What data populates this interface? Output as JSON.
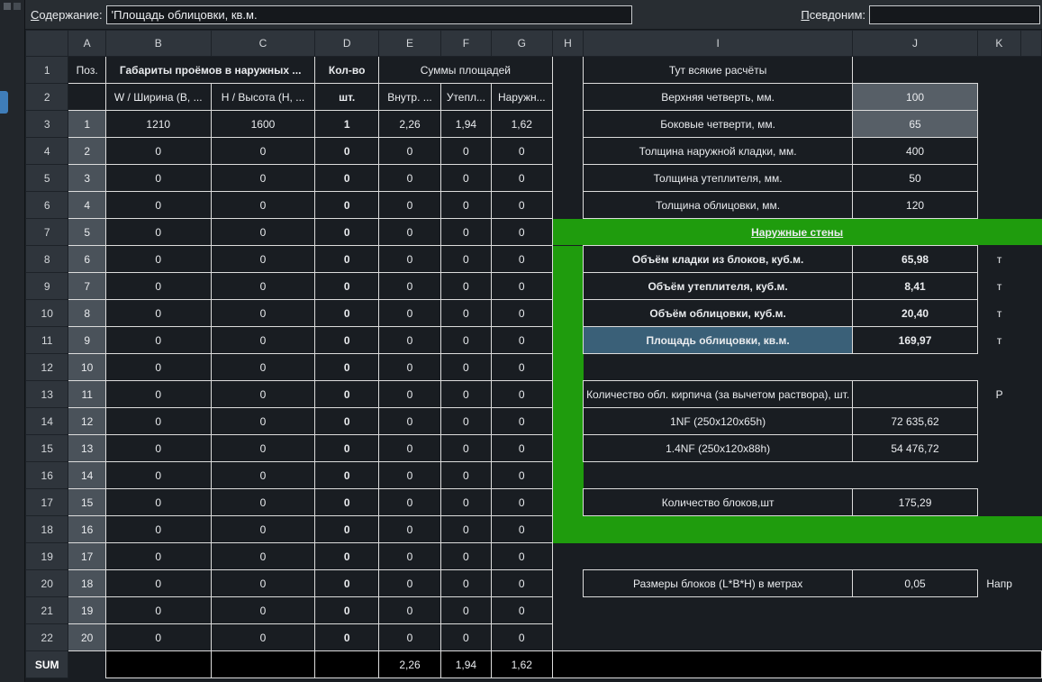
{
  "chrome": {
    "content_label_initial": "С",
    "content_label_rest": "одержание:",
    "content_value": "'Площадь облицовки, кв.м.",
    "alias_label_initial": "П",
    "alias_label_rest": "севдоним:",
    "alias_value": ""
  },
  "colors": {
    "green": "#1f9c0d",
    "selection": "#3a6078",
    "range-fill": "#575f67",
    "badge": "#4a525a",
    "black-row": "#000000",
    "cell-border": "#dcdcdc",
    "header-bg": "#2f353c",
    "cell-bg": "#191d22",
    "topbar-bg": "#282d32",
    "accent-tab": "#3f7db9"
  },
  "sheet": {
    "col_headers": [
      "A",
      "B",
      "C",
      "D",
      "E",
      "F",
      "G",
      "H",
      "I",
      "J",
      "K",
      ""
    ],
    "rows": [
      {
        "h": "1",
        "c": [
          [
            "Поз.",
            "b"
          ],
          [
            "Габариты проёмов в наружных ...",
            "b bold l",
            2
          ],
          [
            "Кол-во",
            "b bold"
          ],
          [
            "Суммы площадей",
            "b",
            3
          ],
          [
            "",
            ""
          ],
          [
            "Тут всякие расчёты",
            "b"
          ],
          [
            "",
            ""
          ],
          [
            "",
            ""
          ],
          [
            "",
            ""
          ]
        ]
      },
      {
        "h": "2",
        "c": [
          [
            "",
            "b"
          ],
          [
            "W / Ширина (В, ...",
            "b l"
          ],
          [
            "H / Высота (H, ...",
            "b l"
          ],
          [
            "шт.",
            "b bold"
          ],
          [
            "Внутр. ...",
            "b l"
          ],
          [
            "Утепл...",
            "b l"
          ],
          [
            "Наружн...",
            "b l"
          ],
          [
            "",
            ""
          ],
          [
            "Верхняя четверть, мм.",
            "b l"
          ],
          [
            "100",
            "range"
          ],
          [
            "",
            ""
          ],
          [
            "",
            ""
          ]
        ]
      },
      {
        "h": "3",
        "c": [
          [
            "1",
            "badge"
          ],
          [
            "1210",
            "b"
          ],
          [
            "1600",
            "b"
          ],
          [
            "1",
            "b bold"
          ],
          [
            "2,26",
            "b"
          ],
          [
            "1,94",
            "b"
          ],
          [
            "1,62",
            "b"
          ],
          [
            "",
            ""
          ],
          [
            "Боковые четверти, мм.",
            "b l"
          ],
          [
            "65",
            "range"
          ],
          [
            "",
            ""
          ],
          [
            "",
            ""
          ]
        ]
      },
      {
        "h": "4",
        "c": [
          [
            "2",
            "badge"
          ],
          [
            "0",
            "b"
          ],
          [
            "0",
            "b"
          ],
          [
            "0",
            "b bold"
          ],
          [
            "0",
            "b"
          ],
          [
            "0",
            "b"
          ],
          [
            "0",
            "b"
          ],
          [
            "",
            ""
          ],
          [
            "Толщина наружной кладки, мм.",
            "b l"
          ],
          [
            "400",
            "b"
          ],
          [
            "",
            ""
          ],
          [
            "",
            ""
          ]
        ]
      },
      {
        "h": "5",
        "c": [
          [
            "3",
            "badge"
          ],
          [
            "0",
            "b"
          ],
          [
            "0",
            "b"
          ],
          [
            "0",
            "b bold"
          ],
          [
            "0",
            "b"
          ],
          [
            "0",
            "b"
          ],
          [
            "0",
            "b"
          ],
          [
            "",
            ""
          ],
          [
            "Толщина утеплителя, мм.",
            "b l"
          ],
          [
            "50",
            "b"
          ],
          [
            "",
            ""
          ],
          [
            "",
            ""
          ]
        ]
      },
      {
        "h": "6",
        "c": [
          [
            "4",
            "badge"
          ],
          [
            "0",
            "b"
          ],
          [
            "0",
            "b"
          ],
          [
            "0",
            "b bold"
          ],
          [
            "0",
            "b"
          ],
          [
            "0",
            "b"
          ],
          [
            "0",
            "b"
          ],
          [
            "",
            ""
          ],
          [
            "Толщина облицовки, мм.",
            "b l"
          ],
          [
            "120",
            "b"
          ],
          [
            "",
            ""
          ],
          [
            "",
            ""
          ]
        ]
      },
      {
        "h": "7",
        "c": [
          [
            "5",
            "badge"
          ],
          [
            "0",
            "b"
          ],
          [
            "0",
            "b"
          ],
          [
            "0",
            "b bold"
          ],
          [
            "0",
            "b"
          ],
          [
            "0",
            "b"
          ],
          [
            "0",
            "b"
          ],
          [
            "Наружные стены",
            "green title",
            5
          ]
        ]
      },
      {
        "h": "8",
        "c": [
          [
            "6",
            "badge"
          ],
          [
            "0",
            "b"
          ],
          [
            "0",
            "b"
          ],
          [
            "0",
            "b bold"
          ],
          [
            "0",
            "b"
          ],
          [
            "0",
            "b"
          ],
          [
            "0",
            "b"
          ],
          [
            "",
            "green"
          ],
          [
            "Объём кладки из блоков, куб.м.",
            "b bold l"
          ],
          [
            "65,98",
            "b bold"
          ],
          [
            "т",
            "ov"
          ],
          [
            "",
            ""
          ]
        ]
      },
      {
        "h": "9",
        "c": [
          [
            "7",
            "badge"
          ],
          [
            "0",
            "b"
          ],
          [
            "0",
            "b"
          ],
          [
            "0",
            "b bold"
          ],
          [
            "0",
            "b"
          ],
          [
            "0",
            "b"
          ],
          [
            "0",
            "b"
          ],
          [
            "",
            "green"
          ],
          [
            "Объём утеплителя, куб.м.",
            "b bold l"
          ],
          [
            "8,41",
            "b bold"
          ],
          [
            "т",
            "ov"
          ],
          [
            "",
            ""
          ]
        ]
      },
      {
        "h": "10",
        "c": [
          [
            "8",
            "badge"
          ],
          [
            "0",
            "b"
          ],
          [
            "0",
            "b"
          ],
          [
            "0",
            "b bold"
          ],
          [
            "0",
            "b"
          ],
          [
            "0",
            "b"
          ],
          [
            "0",
            "b"
          ],
          [
            "",
            "green"
          ],
          [
            "Объём облицовки, куб.м.",
            "b bold l"
          ],
          [
            "20,40",
            "b bold"
          ],
          [
            "т",
            "ov"
          ],
          [
            "",
            ""
          ]
        ]
      },
      {
        "h": "11",
        "c": [
          [
            "9",
            "badge"
          ],
          [
            "0",
            "b"
          ],
          [
            "0",
            "b"
          ],
          [
            "0",
            "b bold"
          ],
          [
            "0",
            "b"
          ],
          [
            "0",
            "b"
          ],
          [
            "0",
            "b"
          ],
          [
            "",
            "green"
          ],
          [
            "Площадь облицовки, кв.м.",
            "sel bold l"
          ],
          [
            "169,97",
            "b bold"
          ],
          [
            "т",
            "ov"
          ],
          [
            "",
            ""
          ]
        ]
      },
      {
        "h": "12",
        "c": [
          [
            "10",
            "badge"
          ],
          [
            "0",
            "b"
          ],
          [
            "0",
            "b"
          ],
          [
            "0",
            "b bold"
          ],
          [
            "0",
            "b"
          ],
          [
            "0",
            "b"
          ],
          [
            "0",
            "b"
          ],
          [
            "",
            "green"
          ],
          [
            "",
            ""
          ],
          [
            "",
            ""
          ],
          [
            "",
            ""
          ],
          [
            "",
            ""
          ]
        ]
      },
      {
        "h": "13",
        "c": [
          [
            "11",
            "badge"
          ],
          [
            "0",
            "b"
          ],
          [
            "0",
            "b"
          ],
          [
            "0",
            "b bold"
          ],
          [
            "0",
            "b"
          ],
          [
            "0",
            "b"
          ],
          [
            "0",
            "b"
          ],
          [
            "",
            "green"
          ],
          [
            "Количество обл. кирпича (за вычетом раствора), шт.",
            "b sm"
          ],
          [
            "",
            "b"
          ],
          [
            "Р",
            "ov"
          ],
          [
            "",
            ""
          ]
        ]
      },
      {
        "h": "14",
        "c": [
          [
            "12",
            "badge"
          ],
          [
            "0",
            "b"
          ],
          [
            "0",
            "b"
          ],
          [
            "0",
            "b bold"
          ],
          [
            "0",
            "b"
          ],
          [
            "0",
            "b"
          ],
          [
            "0",
            "b"
          ],
          [
            "",
            "green"
          ],
          [
            "1NF (250x120x65h)",
            "b l"
          ],
          [
            "72 635,62",
            "b"
          ],
          [
            "",
            ""
          ],
          [
            "",
            ""
          ]
        ]
      },
      {
        "h": "15",
        "c": [
          [
            "13",
            "badge"
          ],
          [
            "0",
            "b"
          ],
          [
            "0",
            "b"
          ],
          [
            "0",
            "b bold"
          ],
          [
            "0",
            "b"
          ],
          [
            "0",
            "b"
          ],
          [
            "0",
            "b"
          ],
          [
            "",
            "green"
          ],
          [
            "1.4NF (250x120x88h)",
            "b l"
          ],
          [
            "54 476,72",
            "b"
          ],
          [
            "",
            ""
          ],
          [
            "",
            ""
          ]
        ]
      },
      {
        "h": "16",
        "c": [
          [
            "14",
            "badge"
          ],
          [
            "0",
            "b"
          ],
          [
            "0",
            "b"
          ],
          [
            "0",
            "b bold"
          ],
          [
            "0",
            "b"
          ],
          [
            "0",
            "b"
          ],
          [
            "0",
            "b"
          ],
          [
            "",
            "green"
          ],
          [
            "",
            ""
          ],
          [
            "",
            ""
          ],
          [
            "",
            ""
          ],
          [
            "",
            ""
          ]
        ]
      },
      {
        "h": "17",
        "c": [
          [
            "15",
            "badge"
          ],
          [
            "0",
            "b"
          ],
          [
            "0",
            "b"
          ],
          [
            "0",
            "b bold"
          ],
          [
            "0",
            "b"
          ],
          [
            "0",
            "b"
          ],
          [
            "0",
            "b"
          ],
          [
            "",
            "green"
          ],
          [
            "Количество блоков,шт",
            "b"
          ],
          [
            "175,29",
            "b"
          ],
          [
            "",
            ""
          ],
          [
            "",
            ""
          ]
        ]
      },
      {
        "h": "18",
        "c": [
          [
            "16",
            "badge"
          ],
          [
            "0",
            "b"
          ],
          [
            "0",
            "b"
          ],
          [
            "0",
            "b bold"
          ],
          [
            "0",
            "b"
          ],
          [
            "0",
            "b"
          ],
          [
            "0",
            "b"
          ],
          [
            "",
            "green",
            5
          ]
        ]
      },
      {
        "h": "19",
        "c": [
          [
            "17",
            "badge"
          ],
          [
            "0",
            "b"
          ],
          [
            "0",
            "b"
          ],
          [
            "0",
            "b bold"
          ],
          [
            "0",
            "b"
          ],
          [
            "0",
            "b"
          ],
          [
            "0",
            "b"
          ],
          [
            "",
            ""
          ],
          [
            "",
            ""
          ],
          [
            "",
            ""
          ],
          [
            "",
            ""
          ],
          [
            "",
            ""
          ]
        ]
      },
      {
        "h": "20",
        "c": [
          [
            "18",
            "badge"
          ],
          [
            "0",
            "b"
          ],
          [
            "0",
            "b"
          ],
          [
            "0",
            "b bold"
          ],
          [
            "0",
            "b"
          ],
          [
            "0",
            "b"
          ],
          [
            "0",
            "b"
          ],
          [
            "",
            ""
          ],
          [
            "Размеры блоков (L*B*H) в метрах",
            "b"
          ],
          [
            "0,05",
            "b"
          ],
          [
            "Напр",
            "ov"
          ],
          [
            "",
            ""
          ]
        ]
      },
      {
        "h": "21",
        "c": [
          [
            "19",
            "badge"
          ],
          [
            "0",
            "b"
          ],
          [
            "0",
            "b"
          ],
          [
            "0",
            "b bold"
          ],
          [
            "0",
            "b"
          ],
          [
            "0",
            "b"
          ],
          [
            "0",
            "b"
          ],
          [
            "",
            ""
          ],
          [
            "",
            ""
          ],
          [
            "",
            ""
          ],
          [
            "",
            ""
          ],
          [
            "",
            ""
          ]
        ]
      },
      {
        "h": "22",
        "c": [
          [
            "20",
            "badge"
          ],
          [
            "0",
            "b"
          ],
          [
            "0",
            "b"
          ],
          [
            "0",
            "b bold"
          ],
          [
            "0",
            "b"
          ],
          [
            "0",
            "b"
          ],
          [
            "0",
            "b"
          ],
          [
            "",
            ""
          ],
          [
            "",
            ""
          ],
          [
            "",
            ""
          ],
          [
            "",
            ""
          ],
          [
            "",
            ""
          ]
        ]
      },
      {
        "h": "SUM",
        "hs": "bold",
        "c": [
          [
            "",
            ""
          ],
          [
            "",
            "blk"
          ],
          [
            "",
            "blk"
          ],
          [
            "",
            "blk"
          ],
          [
            "2,26",
            "blk"
          ],
          [
            "1,94",
            "blk"
          ],
          [
            "1,62",
            "blk"
          ],
          [
            "",
            "blk",
            5
          ]
        ]
      }
    ]
  }
}
